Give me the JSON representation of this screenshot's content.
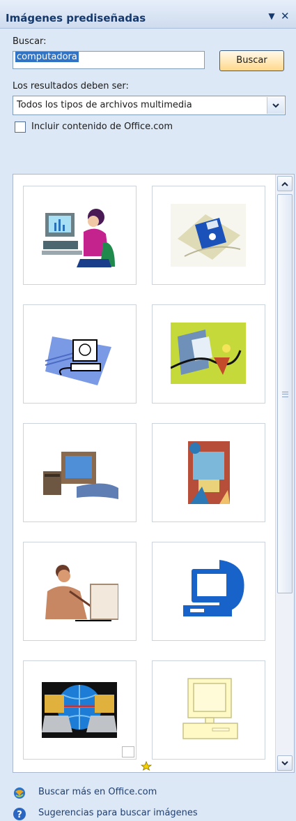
{
  "panel": {
    "title": "Imágenes prediseñadas",
    "menu_arrow": "▼",
    "close_glyph": "✕"
  },
  "search": {
    "label": "Buscar:",
    "value": "computadora",
    "button_label": "Buscar"
  },
  "filter": {
    "label": "Los resultados deben ser:",
    "selected": "Todos los tipos de archivos multimedia",
    "include_office_label": "Incluir contenido de Office.com",
    "include_office_checked": false
  },
  "results": {
    "thumbnails": [
      {
        "icon": "woman-at-computer-icon"
      },
      {
        "icon": "floppy-disk-icon"
      },
      {
        "icon": "network-computer-icon"
      },
      {
        "icon": "computer-cable-icon"
      },
      {
        "icon": "desktop-computer-icon"
      },
      {
        "icon": "computer-collage-icon"
      },
      {
        "icon": "man-at-computer-icon"
      },
      {
        "icon": "blue-computer-icon"
      },
      {
        "icon": "globe-laptops-icon"
      },
      {
        "icon": "yellow-computer-icon"
      }
    ]
  },
  "footer": {
    "search_more_label": "Buscar más en Office.com",
    "tips_label": "Sugerencias para buscar imágenes"
  },
  "colors": {
    "panel_bg": "#dce8f6",
    "title_text": "#15396d",
    "selection": "#3173c5",
    "button_gradient_bottom": "#ffd98c"
  }
}
